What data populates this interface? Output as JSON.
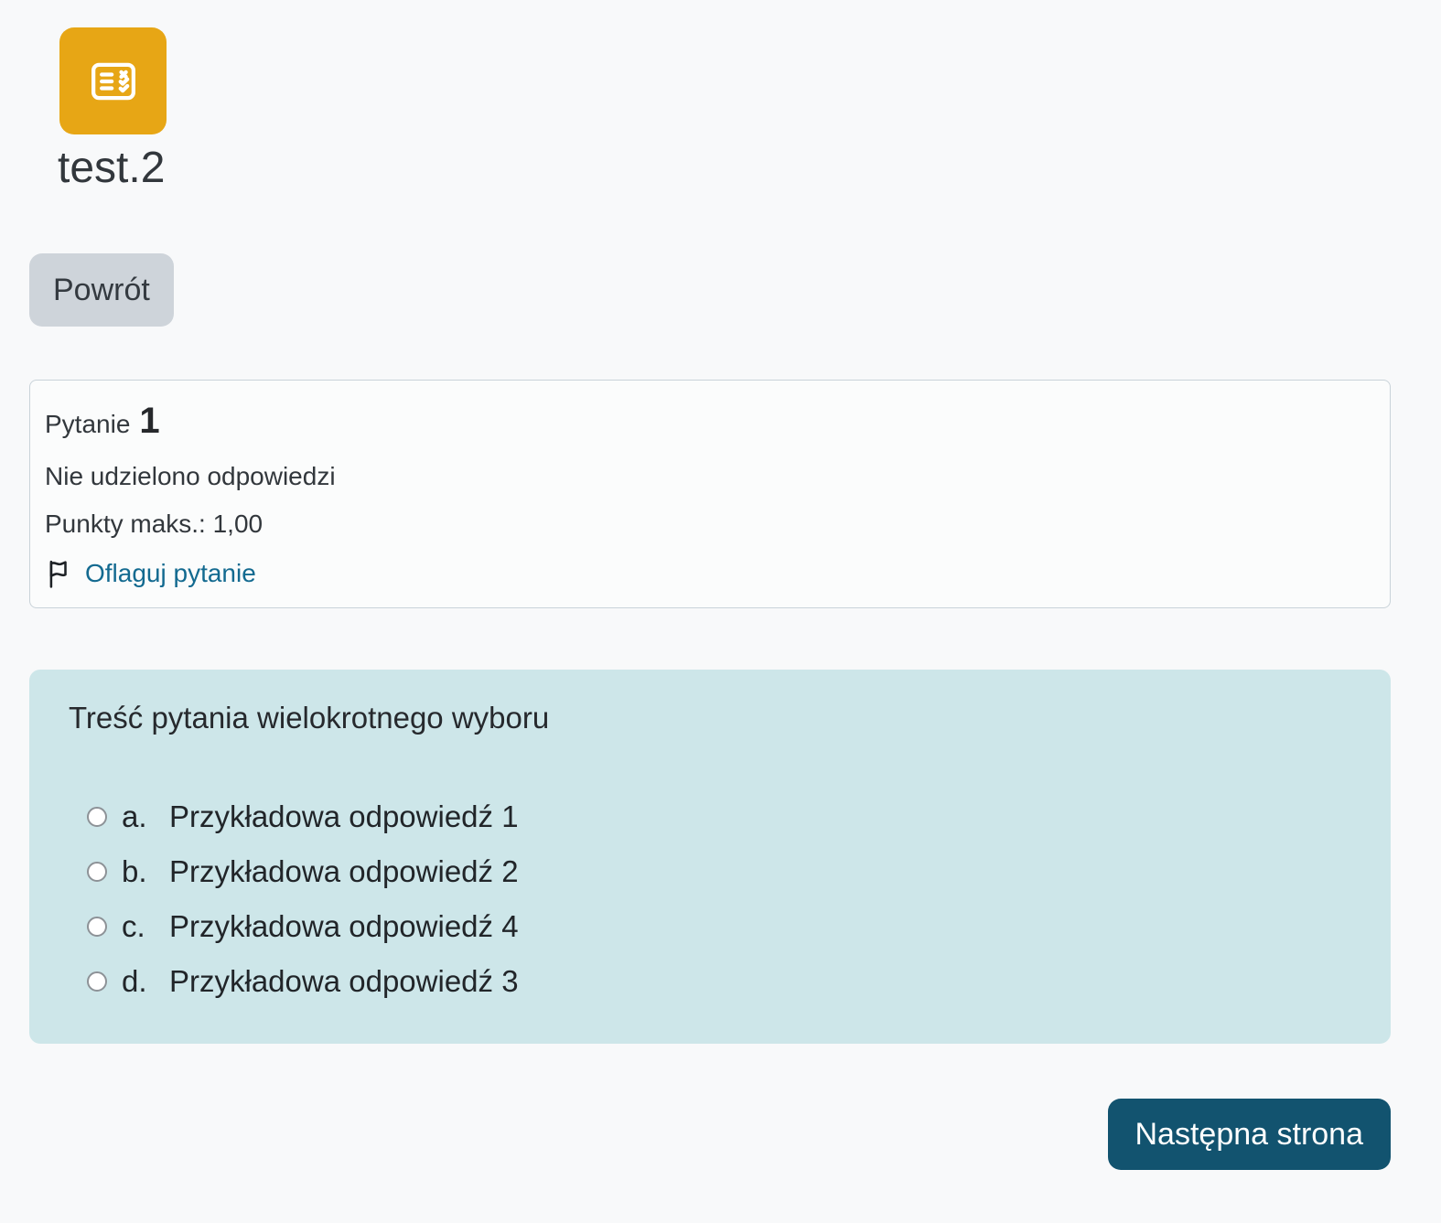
{
  "header": {
    "title": "test.2",
    "icon": "quiz-checklist-icon"
  },
  "back_button": {
    "label": "Powrót"
  },
  "question_info": {
    "label": "Pytanie",
    "number": "1",
    "status": "Nie udzielono odpowiedzi",
    "marks": "Punkty maks.: 1,00",
    "flag_link": "Oflaguj pytanie"
  },
  "question": {
    "text": "Treść pytania wielokrotnego wyboru",
    "options": [
      {
        "letter": "a.",
        "text": "Przykładowa odpowiedź 1"
      },
      {
        "letter": "b.",
        "text": "Przykładowa odpowiedź 2"
      },
      {
        "letter": "c.",
        "text": "Przykładowa odpowiedź 4"
      },
      {
        "letter": "d.",
        "text": "Przykładowa odpowiedź 3"
      }
    ]
  },
  "next_button": {
    "label": "Następna strona"
  },
  "colors": {
    "page_background": "#f8f9fa",
    "icon_background": "#e7a615",
    "back_button_background": "#ced4da",
    "question_box_background": "#cde6e9",
    "next_button_background": "#12536f",
    "link": "#136a90"
  }
}
